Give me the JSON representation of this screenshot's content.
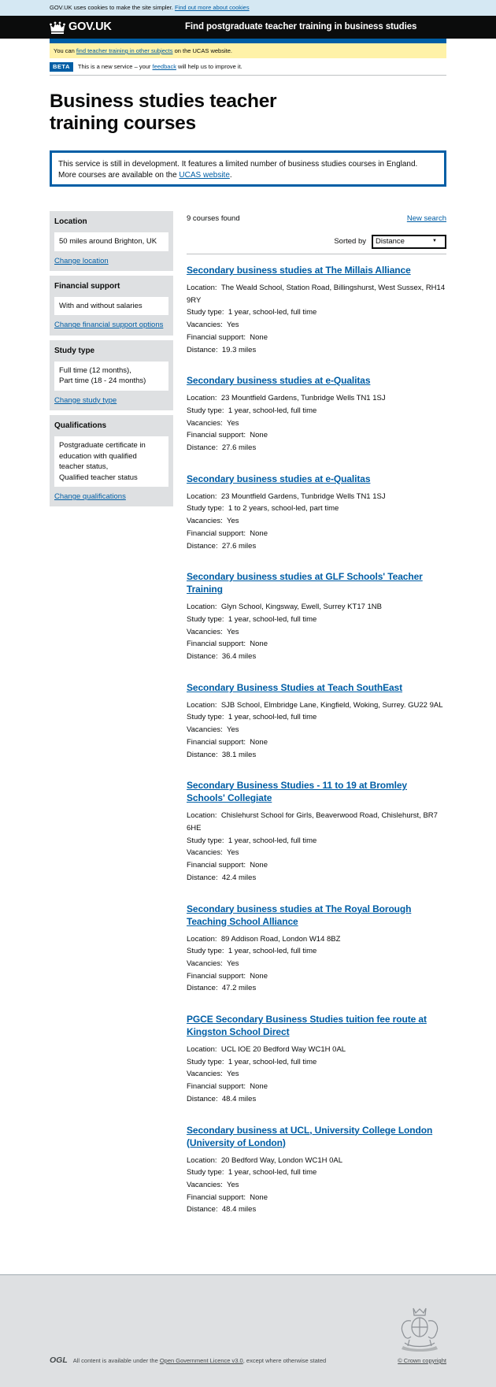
{
  "cookie": {
    "text": "GOV.UK uses cookies to make the site simpler.",
    "link": "Find out more about cookies"
  },
  "header": {
    "logo": "GOV.UK",
    "service": "Find postgraduate teacher training in business studies"
  },
  "notice": {
    "before": "You can ",
    "link": "find teacher training in other subjects",
    "after": " on the UCAS website."
  },
  "phase": {
    "tag": "BETA",
    "before": "This is a new service – your ",
    "link": "feedback",
    "after": " will help us to improve it."
  },
  "page_title": "Business studies teacher training courses",
  "callout": {
    "line1": "This service is still in development. It features a limited number of business studies courses in England.",
    "line2_before": "More courses are available on the ",
    "line2_link": "UCAS website",
    "line2_after": "."
  },
  "filters": [
    {
      "heading": "Location",
      "values": [
        "50 miles around Brighton, UK"
      ],
      "link": "Change location"
    },
    {
      "heading": "Financial support",
      "values": [
        "With and without salaries"
      ],
      "link": "Change financial support options"
    },
    {
      "heading": "Study type",
      "values": [
        "Full time (12 months),",
        "Part time (18 - 24 months)"
      ],
      "link": "Change study type"
    },
    {
      "heading": "Qualifications",
      "values": [
        "Postgraduate certificate in education with qualified teacher status,",
        "Qualified teacher status"
      ],
      "link": "Change qualifications"
    }
  ],
  "results": {
    "count": "9 courses found",
    "new_search": "New search",
    "sort_label": "Sorted by",
    "sort_value": "Distance"
  },
  "field_labels": {
    "location": "Location:",
    "study_type": "Study type:",
    "vacancies": "Vacancies:",
    "financial": "Financial support:",
    "distance": "Distance:"
  },
  "courses": [
    {
      "title": "Secondary business studies at The Millais Alliance",
      "location": "The Weald School, Station Road, Billingshurst, West Sussex, RH14 9RY",
      "study_type": "1 year, school-led, full time",
      "vacancies": "Yes",
      "financial": "None",
      "distance": "19.3 miles"
    },
    {
      "title": "Secondary business studies at e-Qualitas",
      "location": "23 Mountfield Gardens, Tunbridge Wells TN1 1SJ",
      "study_type": "1 year, school-led, full time",
      "vacancies": "Yes",
      "financial": "None",
      "distance": "27.6 miles"
    },
    {
      "title": "Secondary business studies at e-Qualitas",
      "location": "23 Mountfield Gardens, Tunbridge Wells TN1 1SJ",
      "study_type": "1 to 2 years, school-led, part time",
      "vacancies": "Yes",
      "financial": "None",
      "distance": "27.6 miles"
    },
    {
      "title": "Secondary business studies at GLF Schools' Teacher Training",
      "location": "Glyn School, Kingsway, Ewell, Surrey KT17 1NB",
      "study_type": "1 year, school-led, full time",
      "vacancies": "Yes",
      "financial": "None",
      "distance": "36.4 miles"
    },
    {
      "title": "Secondary Business Studies at Teach SouthEast",
      "location": "SJB School, Elmbridge Lane, Kingfield, Woking, Surrey. GU22 9AL",
      "study_type": "1 year, school-led, full time",
      "vacancies": "Yes",
      "financial": "None",
      "distance": "38.1 miles"
    },
    {
      "title": "Secondary Business Studies - 11 to 19 at Bromley Schools' Collegiate",
      "location": "Chislehurst School for Girls, Beaverwood Road, Chislehurst, BR7 6HE",
      "study_type": "1 year, school-led, full time",
      "vacancies": "Yes",
      "financial": "None",
      "distance": "42.4 miles"
    },
    {
      "title": "Secondary business studies at The Royal Borough Teaching School Alliance",
      "location": "89 Addison Road, London W14 8BZ",
      "study_type": "1 year, school-led, full time",
      "vacancies": "Yes",
      "financial": "None",
      "distance": "47.2 miles"
    },
    {
      "title": "PGCE Secondary Business Studies tuition fee route at Kingston School Direct",
      "location": "UCL IOE 20 Bedford Way WC1H 0AL",
      "study_type": "1 year, school-led, full time",
      "vacancies": "Yes",
      "financial": "None",
      "distance": "48.4 miles"
    },
    {
      "title": "Secondary business at UCL, University College London (University of London)",
      "location": "20 Bedford Way, London WC1H 0AL",
      "study_type": "1 year, school-led, full time",
      "vacancies": "Yes",
      "financial": "None",
      "distance": "48.4 miles"
    }
  ],
  "footer": {
    "ogl": "OGL",
    "licence_before": "All content is available under the ",
    "licence_link": "Open Government Licence v3.0",
    "licence_after": ", except where otherwise stated",
    "copyright": "© Crown copyright",
    "crest_icon": "royal-coat-of-arms"
  },
  "colors": {
    "link": "#005ea5",
    "header_bg": "#0b0c0c",
    "notice_bg": "#fff2a8",
    "cookie_bg": "#d5e8f3",
    "panel_bg": "#dee0e2"
  }
}
